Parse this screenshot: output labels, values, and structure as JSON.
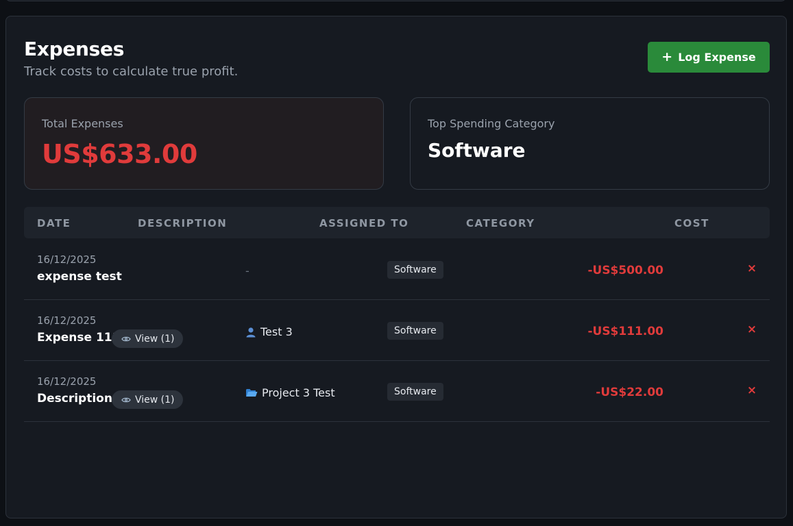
{
  "header": {
    "title": "Expenses",
    "subtitle": "Track costs to calculate true profit.",
    "log_button_label": "Log Expense"
  },
  "summary": {
    "total_label": "Total Expenses",
    "total_value": "US$633.00",
    "top_category_label": "Top Spending Category",
    "top_category_value": "Software"
  },
  "table": {
    "columns": [
      "DATE",
      "DESCRIPTION",
      "ASSIGNED TO",
      "CATEGORY",
      "COST"
    ],
    "rows": [
      {
        "date": "16/12/2025",
        "description": "expense test",
        "view": "",
        "assigned_icon": "",
        "assigned": "-",
        "category": "Software",
        "cost": "-US$500.00",
        "delete": "×"
      },
      {
        "date": "16/12/2025",
        "description": "Expense 111",
        "view": "View (1)",
        "assigned_icon": "person-icon",
        "assigned": "Test 3",
        "category": "Software",
        "cost": "-US$111.00",
        "delete": "×"
      },
      {
        "date": "16/12/2025",
        "description": "Description",
        "view": "View (1)",
        "assigned_icon": "folder-icon",
        "assigned": "Project 3 Test",
        "category": "Software",
        "cost": "-US$22.00",
        "delete": "×"
      }
    ]
  },
  "colors": {
    "accent_green": "#2a8a3a",
    "negative_red": "#e03b3b",
    "panel_bg": "#161a21"
  }
}
